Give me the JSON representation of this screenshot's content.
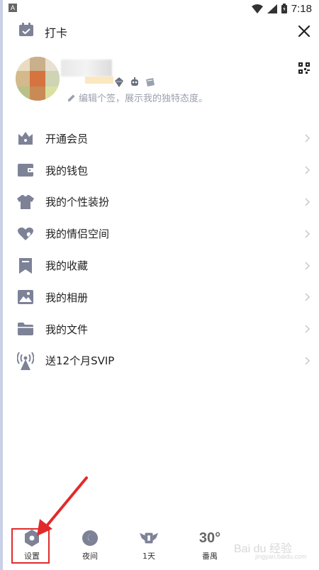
{
  "status_bar": {
    "time": "7:18",
    "left_badge": "A"
  },
  "header": {
    "checkin_label": "打卡"
  },
  "profile": {
    "signature": "编辑个签，展示我的独特态度。"
  },
  "menu": [
    {
      "label": "开通会员",
      "icon": "crown-icon"
    },
    {
      "label": "我的钱包",
      "icon": "wallet-icon"
    },
    {
      "label": "我的个性装扮",
      "icon": "tshirt-icon"
    },
    {
      "label": "我的情侣空间",
      "icon": "heart-icon"
    },
    {
      "label": "我的收藏",
      "icon": "bookmark-icon"
    },
    {
      "label": "我的相册",
      "icon": "image-icon"
    },
    {
      "label": "我的文件",
      "icon": "folder-icon"
    },
    {
      "label": "送12个月SVIP",
      "icon": "broadcast-icon"
    }
  ],
  "bottom_bar": {
    "settings_label": "设置",
    "night_label": "夜间",
    "days_label": "1天",
    "weather_temp": "30°",
    "weather_city": "番禺"
  },
  "watermark": {
    "text": "Bai du 经验",
    "sub": "jingyan.baidu.com"
  },
  "colors": {
    "icon": "#7d8297",
    "highlight": "#e12b2b",
    "text": "#222222",
    "secondary": "#9aa0ad"
  }
}
